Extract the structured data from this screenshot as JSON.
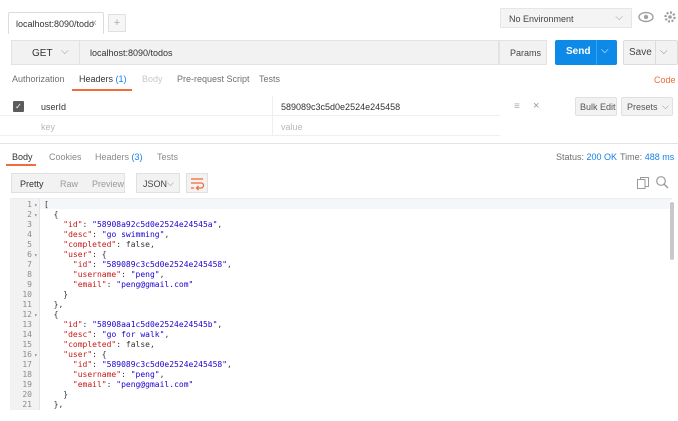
{
  "tab": {
    "label": "localhost:8090/todo",
    "close": "×",
    "new": "+"
  },
  "environment": {
    "label": "No Environment"
  },
  "request": {
    "method": "GET",
    "url": "localhost:8090/todos",
    "params_label": "Params",
    "send_label": "Send",
    "save_label": "Save"
  },
  "request_tabs": {
    "authorization": "Authorization",
    "headers": "Headers",
    "headers_count": "(1)",
    "body": "Body",
    "prerequest": "Pre-request Script",
    "tests": "Tests",
    "code": "Code"
  },
  "headers": {
    "rows": [
      {
        "key": "userId",
        "value": "589089c3c5d0e2524e245458",
        "enabled": true
      }
    ],
    "key_placeholder": "key",
    "value_placeholder": "value",
    "bulk_edit_label": "Bulk Edit",
    "presets_label": "Presets"
  },
  "response_tabs": {
    "body": "Body",
    "cookies": "Cookies",
    "headers": "Headers",
    "headers_count": "(3)",
    "tests": "Tests"
  },
  "response_meta": {
    "status_label": "Status:",
    "status_value": "200 OK",
    "time_label": "Time:",
    "time_value": "488 ms"
  },
  "view": {
    "pretty": "Pretty",
    "raw": "Raw",
    "preview": "Preview",
    "format": "JSON"
  },
  "colors": {
    "accent": "#f26b3a",
    "send": "#0d8ae8",
    "link": "#1580e8"
  },
  "code_lines": [
    {
      "n": "1",
      "fold": true,
      "parts": [
        [
          "p",
          "["
        ]
      ]
    },
    {
      "n": "2",
      "fold": true,
      "parts": [
        [
          "p",
          "  {"
        ]
      ]
    },
    {
      "n": "3",
      "fold": false,
      "parts": [
        [
          "k",
          "    \"id\""
        ],
        [
          "p",
          ": "
        ],
        [
          "s",
          "\"58908a92c5d0e2524e24545a\""
        ],
        [
          "p",
          ","
        ]
      ]
    },
    {
      "n": "4",
      "fold": false,
      "parts": [
        [
          "k",
          "    \"desc\""
        ],
        [
          "p",
          ": "
        ],
        [
          "s",
          "\"go swimming\""
        ],
        [
          "p",
          ","
        ]
      ]
    },
    {
      "n": "5",
      "fold": false,
      "parts": [
        [
          "k",
          "    \"completed\""
        ],
        [
          "p",
          ": false,"
        ]
      ]
    },
    {
      "n": "6",
      "fold": true,
      "parts": [
        [
          "k",
          "    \"user\""
        ],
        [
          "p",
          ": {"
        ]
      ]
    },
    {
      "n": "7",
      "fold": false,
      "parts": [
        [
          "k",
          "      \"id\""
        ],
        [
          "p",
          ": "
        ],
        [
          "s",
          "\"589089c3c5d0e2524e245458\""
        ],
        [
          "p",
          ","
        ]
      ]
    },
    {
      "n": "8",
      "fold": false,
      "parts": [
        [
          "k",
          "      \"username\""
        ],
        [
          "p",
          ": "
        ],
        [
          "s",
          "\"peng\""
        ],
        [
          "p",
          ","
        ]
      ]
    },
    {
      "n": "9",
      "fold": false,
      "parts": [
        [
          "k",
          "      \"email\""
        ],
        [
          "p",
          ": "
        ],
        [
          "s",
          "\"peng@gmail.com\""
        ]
      ]
    },
    {
      "n": "10",
      "fold": false,
      "parts": [
        [
          "p",
          "    }"
        ]
      ]
    },
    {
      "n": "11",
      "fold": false,
      "parts": [
        [
          "p",
          "  },"
        ]
      ]
    },
    {
      "n": "12",
      "fold": true,
      "parts": [
        [
          "p",
          "  {"
        ]
      ]
    },
    {
      "n": "13",
      "fold": false,
      "parts": [
        [
          "k",
          "    \"id\""
        ],
        [
          "p",
          ": "
        ],
        [
          "s",
          "\"58908aa1c5d0e2524e24545b\""
        ],
        [
          "p",
          ","
        ]
      ]
    },
    {
      "n": "14",
      "fold": false,
      "parts": [
        [
          "k",
          "    \"desc\""
        ],
        [
          "p",
          ": "
        ],
        [
          "s",
          "\"go for walk\""
        ],
        [
          "p",
          ","
        ]
      ]
    },
    {
      "n": "15",
      "fold": false,
      "parts": [
        [
          "k",
          "    \"completed\""
        ],
        [
          "p",
          ": false,"
        ]
      ]
    },
    {
      "n": "16",
      "fold": true,
      "parts": [
        [
          "k",
          "    \"user\""
        ],
        [
          "p",
          ": {"
        ]
      ]
    },
    {
      "n": "17",
      "fold": false,
      "parts": [
        [
          "k",
          "      \"id\""
        ],
        [
          "p",
          ": "
        ],
        [
          "s",
          "\"589089c3c5d0e2524e245458\""
        ],
        [
          "p",
          ","
        ]
      ]
    },
    {
      "n": "18",
      "fold": false,
      "parts": [
        [
          "k",
          "      \"username\""
        ],
        [
          "p",
          ": "
        ],
        [
          "s",
          "\"peng\""
        ],
        [
          "p",
          ","
        ]
      ]
    },
    {
      "n": "19",
      "fold": false,
      "parts": [
        [
          "k",
          "      \"email\""
        ],
        [
          "p",
          ": "
        ],
        [
          "s",
          "\"peng@gmail.com\""
        ]
      ]
    },
    {
      "n": "20",
      "fold": false,
      "parts": [
        [
          "p",
          "    }"
        ]
      ]
    },
    {
      "n": "21",
      "fold": false,
      "parts": [
        [
          "p",
          "  },"
        ]
      ]
    }
  ]
}
